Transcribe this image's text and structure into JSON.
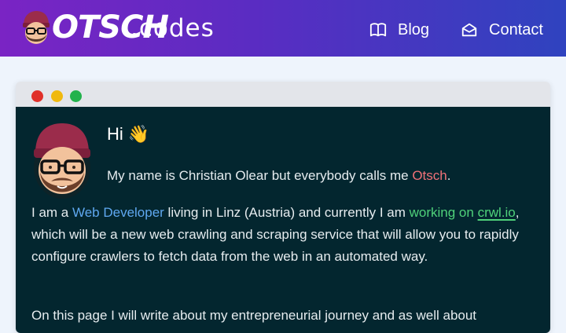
{
  "header": {
    "logo_word": "OTSCH",
    "logo_suffix": ".codes",
    "nav": [
      {
        "label": "Blog",
        "icon": "book-icon"
      },
      {
        "label": "Contact",
        "icon": "envelope-icon"
      }
    ]
  },
  "window": {
    "greeting": "Hi 👋",
    "intro": {
      "before": "My name is Christian Olear but everybody calls me ",
      "nickname": "Otsch",
      "after": "."
    },
    "paragraph1": {
      "t1": "I am a ",
      "role": "Web Developer",
      "t2": " living in Linz (Austria) and currently I am ",
      "working_on": "working on",
      "t3": " ",
      "project_link": "crwl.io",
      "t4": ", which will be a new web crawling and scraping service that will allow you to rapidly configure crawlers to fetch data from the web in an automated way."
    },
    "paragraph2": "On this page I will write about my entrepreneurial journey and as well about"
  },
  "colors": {
    "header_start": "#7a24c4",
    "header_end": "#2f43bf",
    "terminal_bg": "#03262f",
    "nickname": "#f07178",
    "role": "#5fa8f0",
    "working_on": "#4fd17a"
  }
}
